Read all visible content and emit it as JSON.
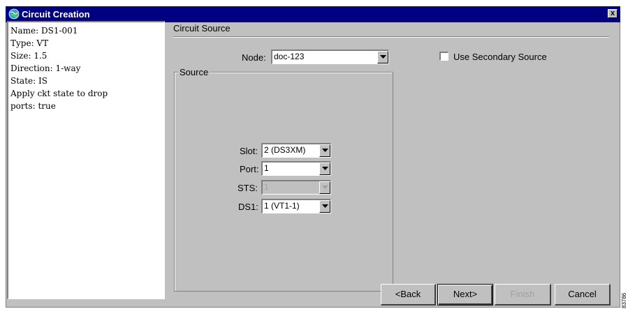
{
  "window": {
    "title": "Circuit Creation",
    "close_label": "x"
  },
  "info": {
    "lines": [
      "Name: DS1-001",
      "Type: VT",
      "Size: 1.5",
      "Direction: 1-way",
      "State: IS",
      "Apply ckt state to drop",
      "ports: true"
    ]
  },
  "circuit_source": {
    "title": "Circuit Source",
    "node_label": "Node:",
    "node_value": "doc-123",
    "secondary_label": "Use Secondary Source",
    "secondary_checked": false,
    "source_group_label": "Source",
    "slot_label": "Slot:",
    "slot_value": "2 (DS3XM)",
    "port_label": "Port:",
    "port_value": "1",
    "sts_label": "STS:",
    "sts_value": "1",
    "ds1_label": "DS1:",
    "ds1_value": "1 (VT1-1)"
  },
  "buttons": {
    "back": "<Back",
    "next": "Next>",
    "finish": "Finish",
    "cancel": "Cancel"
  },
  "side_id": "83786"
}
